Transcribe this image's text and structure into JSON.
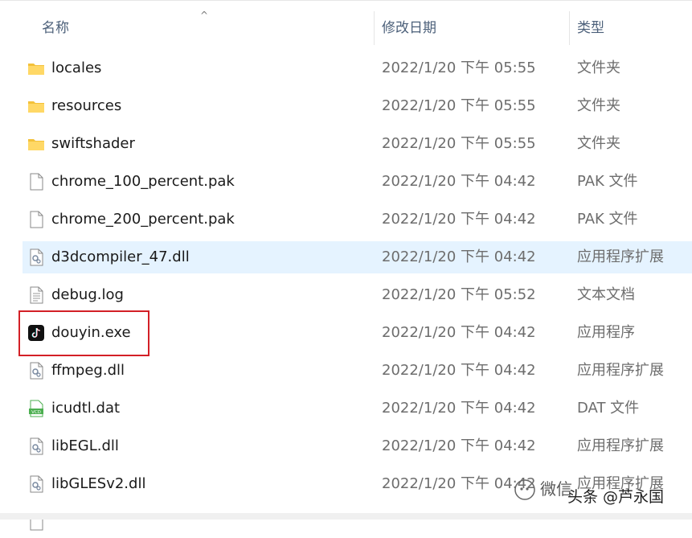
{
  "header": {
    "name_label": "名称",
    "date_label": "修改日期",
    "type_label": "类型",
    "sort_indicator": "^"
  },
  "rows": [
    {
      "name": "locales",
      "date": "2022/1/20 下午 05:55",
      "type": "文件夹",
      "icon": "folder-icon"
    },
    {
      "name": "resources",
      "date": "2022/1/20 下午 05:55",
      "type": "文件夹",
      "icon": "folder-icon"
    },
    {
      "name": "swiftshader",
      "date": "2022/1/20 下午 05:55",
      "type": "文件夹",
      "icon": "folder-icon"
    },
    {
      "name": "chrome_100_percent.pak",
      "date": "2022/1/20 下午 04:42",
      "type": "PAK 文件",
      "icon": "file-icon"
    },
    {
      "name": "chrome_200_percent.pak",
      "date": "2022/1/20 下午 04:42",
      "type": "PAK 文件",
      "icon": "file-icon"
    },
    {
      "name": "d3dcompiler_47.dll",
      "date": "2022/1/20 下午 04:42",
      "type": "应用程序扩展",
      "icon": "dll-icon",
      "selected": true
    },
    {
      "name": "debug.log",
      "date": "2022/1/20 下午 05:52",
      "type": "文本文档",
      "icon": "text-file-icon"
    },
    {
      "name": "douyin.exe",
      "date": "2022/1/20 下午 04:42",
      "type": "应用程序",
      "icon": "douyin-app-icon"
    },
    {
      "name": "ffmpeg.dll",
      "date": "2022/1/20 下午 04:42",
      "type": "应用程序扩展",
      "icon": "dll-icon"
    },
    {
      "name": "icudtl.dat",
      "date": "2022/1/20 下午 04:42",
      "type": "DAT 文件",
      "icon": "vcd-file-icon"
    },
    {
      "name": "libEGL.dll",
      "date": "2022/1/20 下午 04:42",
      "type": "应用程序扩展",
      "icon": "dll-icon"
    },
    {
      "name": "libGLESv2.dll",
      "date": "2022/1/20 下午 04:42",
      "type": "应用程序扩展",
      "icon": "dll-icon"
    }
  ],
  "colors": {
    "selected_row": "#e5f3ff",
    "highlight_box": "#d32027",
    "folder": "#f5c542"
  },
  "watermark": {
    "line1": "微信",
    "line2": "头条 @芦永国"
  }
}
